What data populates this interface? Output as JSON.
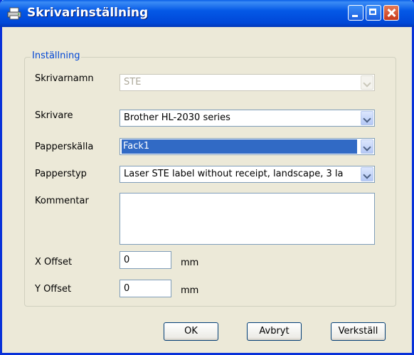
{
  "window": {
    "title": "Skrivarinställning",
    "icon": "printer-icon"
  },
  "group": {
    "title": "Inställning"
  },
  "fields": {
    "printer_name": {
      "label": "Skrivarnamn",
      "value": "STE"
    },
    "printer": {
      "label": "Skrivare",
      "value": "Brother HL-2030 series"
    },
    "paper_source": {
      "label": "Papperskälla",
      "value": "Fack1"
    },
    "paper_type": {
      "label": "Papperstyp",
      "value": "Laser STE label without receipt, landscape, 3 la"
    },
    "comment": {
      "label": "Kommentar",
      "value": ""
    },
    "x_offset": {
      "label": "X Offset",
      "value": "0",
      "unit": "mm"
    },
    "y_offset": {
      "label": "Y Offset",
      "value": "0",
      "unit": "mm"
    }
  },
  "buttons": {
    "ok": "OK",
    "cancel": "Avbryt",
    "apply": "Verkställ"
  },
  "colors": {
    "titlebar": "#0458e6",
    "group_title": "#0046d5",
    "selection": "#316ac5",
    "dialog_bg": "#ece9d8"
  }
}
